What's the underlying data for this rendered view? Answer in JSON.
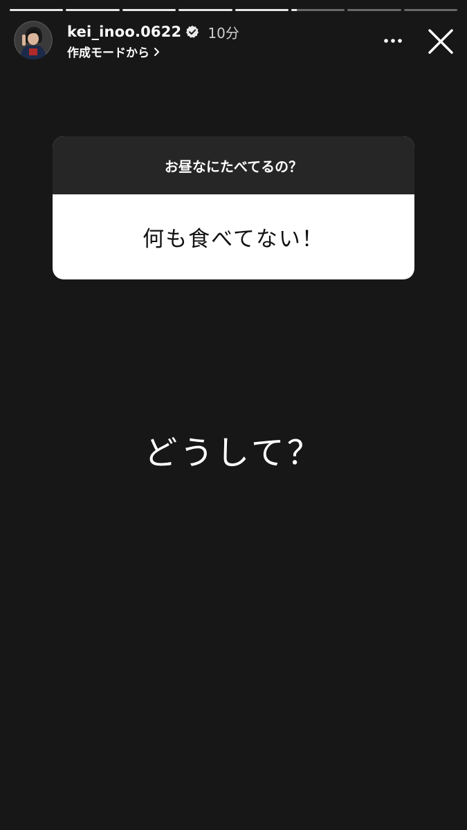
{
  "story": {
    "progress": [
      1,
      1,
      1,
      1,
      1,
      0.1,
      0,
      0
    ],
    "user": {
      "username": "kei_inoo.0622",
      "verified": true,
      "time_ago": "10分",
      "source_label": "作成モードから"
    },
    "icons": {
      "more": "more-horizontal-icon",
      "close": "close-icon",
      "verified": "verified-badge-icon",
      "chevron": "chevron-right-icon"
    },
    "question_sticker": {
      "question": "お昼なにたべてるの？",
      "answer": "何も食べてない！"
    },
    "reply_text": "どうして？"
  },
  "colors": {
    "background": "#171717",
    "question_header": "#262626",
    "answer_bg": "#ffffff",
    "text_primary": "#ffffff"
  }
}
